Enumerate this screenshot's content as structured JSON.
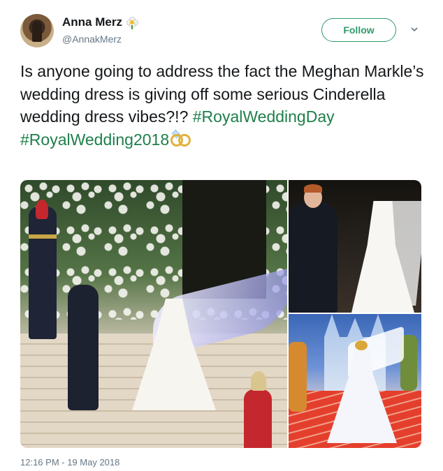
{
  "user": {
    "display_name": "Anna Merz",
    "handle": "@AnnakMerz",
    "avatar_icon": "avatar-photo",
    "badge_icon": "daisy-flower-icon"
  },
  "actions": {
    "follow_label": "Follow",
    "menu_icon": "chevron-down-icon"
  },
  "tweet": {
    "text_plain": "Is anyone going to address the fact the Meghan Markle’s wedding dress is giving off some serious Cinderella wedding dress vibes?!? ",
    "hashtag_1": "#RoyalWeddingDay",
    "hashtag_2": "#RoyalWedding2018",
    "emoji_icon": "wedding-rings-icon"
  },
  "media": {
    "photos": [
      "wedding-steps-photo",
      "couple-closeup-photo",
      "cinderella-animation-still"
    ]
  },
  "meta": {
    "timestamp": "12:16 PM - 19 May 2018"
  },
  "colors": {
    "hashtag": "#1e7f4a",
    "follow": "#2e9a6a",
    "secondary_text": "#657786"
  }
}
